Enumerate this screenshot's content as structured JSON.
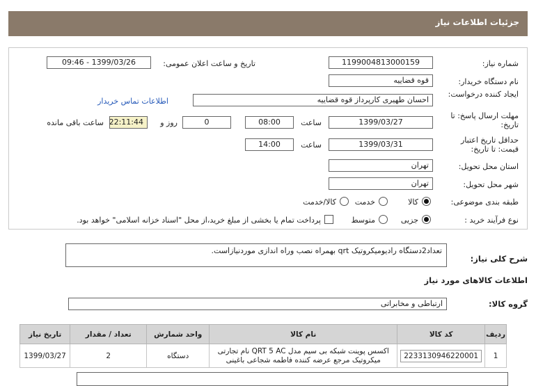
{
  "header": {
    "title": "جزئیات اطلاعات نیاز"
  },
  "form": {
    "need_number_label": "شماره نیاز:",
    "need_number": "1199004813000159",
    "announce_label": "تاریخ و ساعت اعلان عمومی:",
    "announce_value": "1399/03/26 - 09:46",
    "buyer_label": "نام دستگاه خریدار:",
    "buyer": "قوه قضاییه",
    "creator_label": "ایجاد کننده درخواست:",
    "creator": "احسان طهیری کارپرداز قوه قضاییه",
    "contact_link": "اطلاعات تماس خریدار",
    "deadline_label": "مهلت ارسال پاسخ: تا تاریخ:",
    "deadline_date": "1399/03/27",
    "time_label": "ساعت",
    "deadline_time": "08:00",
    "days_value": "0",
    "days_label": "روز و",
    "remaining_time": "22:11:44",
    "remaining_label": "ساعت باقی مانده",
    "validity_label": "حداقل تاریخ اعتبار قیمت: تا تاریخ:",
    "validity_date": "1399/03/31",
    "validity_time": "14:00",
    "province_label": "استان محل تحویل:",
    "province": "تهران",
    "city_label": "شهر محل تحویل:",
    "city": "تهران",
    "category_label": "طبقه بندی موضوعی:",
    "cat_goods": "کالا",
    "cat_service": "خدمت",
    "cat_both": "کالا/خدمت",
    "process_label": "نوع فرآیند خرید :",
    "proc_partial": "جزیی",
    "proc_medium": "متوسط",
    "payment_note": "پرداخت تمام یا بخشی از مبلغ خرید،از محل \"اسناد خزانه اسلامی\" خواهد بود."
  },
  "summary": {
    "label": "شرح کلی نیاز:",
    "text": "تعداد2دستگاه رادیومیکروتیک qrt بهمراه نصب وراه اندازی موردنیازاست."
  },
  "goods": {
    "section_title": "اطلاعات کالاهای مورد نیاز",
    "group_label": "گروه کالا:",
    "group_value": "ارتباطی و مخابراتی",
    "columns": [
      "ردیف",
      "کد کالا",
      "نام کالا",
      "واحد شمارش",
      "تعداد / مقدار",
      "تاریخ نیاز"
    ],
    "rows": [
      {
        "row": "1",
        "code": "2233130946220001",
        "name": "اکسس پوینت شبکه بی سیم مدل QRT 5 AC نام تجارتی میکروتیک مرجع عرضه کننده فاطمه شجاعی باغینی",
        "unit": "دستگاه",
        "qty": "2",
        "date": "1399/03/27"
      }
    ]
  }
}
